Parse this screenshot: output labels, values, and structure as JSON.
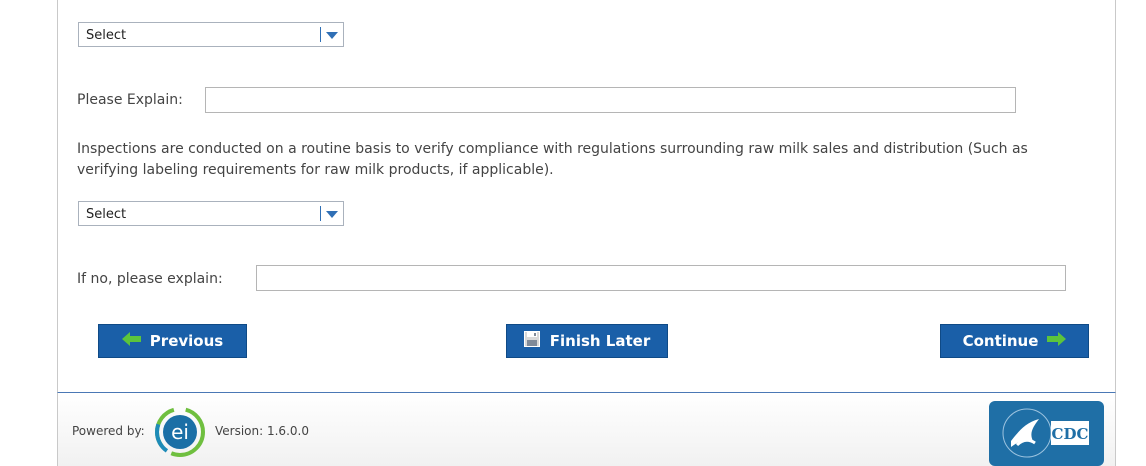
{
  "form": {
    "select1": {
      "value": "Select"
    },
    "explain1": {
      "label": "Please Explain:",
      "value": ""
    },
    "question": {
      "text": "Inspections are conducted on a routine basis to verify compliance with regulations surrounding raw milk sales and distribution (Such as verifying labeling requirements for raw milk products, if applicable)."
    },
    "select2": {
      "value": "Select"
    },
    "explain2": {
      "label": "If no, please explain:",
      "value": ""
    }
  },
  "buttons": {
    "previous": "Previous",
    "finish_later": "Finish Later",
    "continue": "Continue"
  },
  "footer": {
    "powered_by": "Powered by:",
    "ei_logo_text": "ei",
    "version": "Version: 1.6.0.0",
    "cdc_logo_text": "CDC"
  },
  "colors": {
    "button_blue": "#1a5fa8",
    "arrow_green": "#5cc43c",
    "select_arrow": "#2f6fb5",
    "footer_border": "#4a78b5",
    "cdc_blue": "#1f6fa6"
  },
  "icons": {
    "previous": "arrow-left-icon",
    "finish_later": "save-icon",
    "continue": "arrow-right-icon",
    "dropdown": "chevron-down-icon"
  }
}
